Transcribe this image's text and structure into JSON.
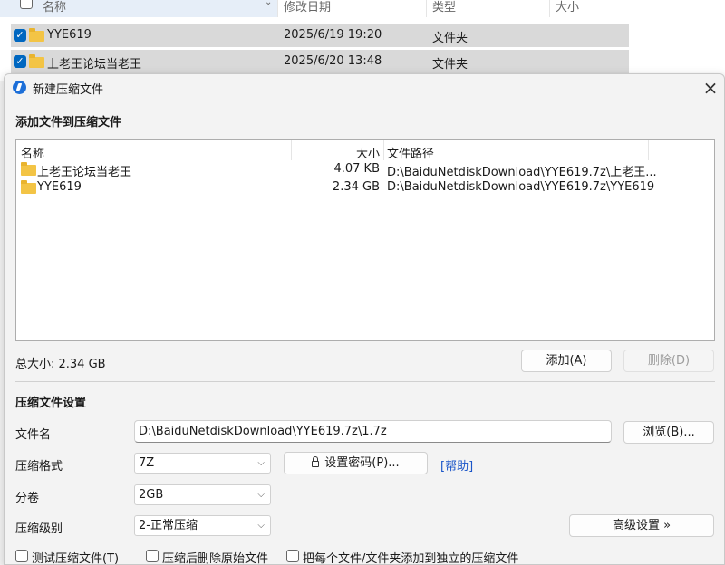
{
  "explorer": {
    "columns": {
      "name": "名称",
      "modified": "修改日期",
      "type": "类型",
      "size": "大小"
    },
    "rows": [
      {
        "name": "YYE619",
        "modified": "2025/6/19 19:20",
        "type": "文件夹"
      },
      {
        "name": "上老王论坛当老王",
        "modified": "2025/6/20 13:48",
        "type": "文件夹"
      }
    ]
  },
  "dialog": {
    "title": "新建压缩文件",
    "add_section_title": "添加文件到压缩文件",
    "list_columns": {
      "name": "名称",
      "size": "大小",
      "path": "文件路径"
    },
    "files": [
      {
        "name": "上老王论坛当老王",
        "size": "4.07 KB",
        "path": "D:\\BaiduNetdiskDownload\\YYE619.7z\\上老王..."
      },
      {
        "name": "YYE619",
        "size": "2.34 GB",
        "path": "D:\\BaiduNetdiskDownload\\YYE619.7z\\YYE619"
      }
    ],
    "total_size": "总大小: 2.34 GB",
    "add_button": "添加(A)",
    "delete_button": "删除(D)",
    "settings_title": "压缩文件设置",
    "filename_label": "文件名",
    "filename_value": "D:\\BaiduNetdiskDownload\\YYE619.7z\\1.7z",
    "browse_button": "浏览(B)...",
    "format_label": "压缩格式",
    "format_value": "7Z",
    "password_button": "设置密码(P)...",
    "help_link": "[帮助]",
    "volume_label": "分卷",
    "volume_value": "2GB",
    "level_label": "压缩级别",
    "level_value": "2-正常压缩",
    "advanced_button": "高级设置 »",
    "options": [
      {
        "label": "测试压缩文件(T)",
        "checked": false
      },
      {
        "label": "压缩后删除原始文件",
        "checked": false
      },
      {
        "label": "把每个文件/文件夹添加到独立的压缩文件",
        "checked": false
      }
    ]
  },
  "colors": {
    "accent": "#0067c0",
    "selection": "#d9d9d9",
    "folder": "#f3c445",
    "link": "#1a55c8"
  }
}
